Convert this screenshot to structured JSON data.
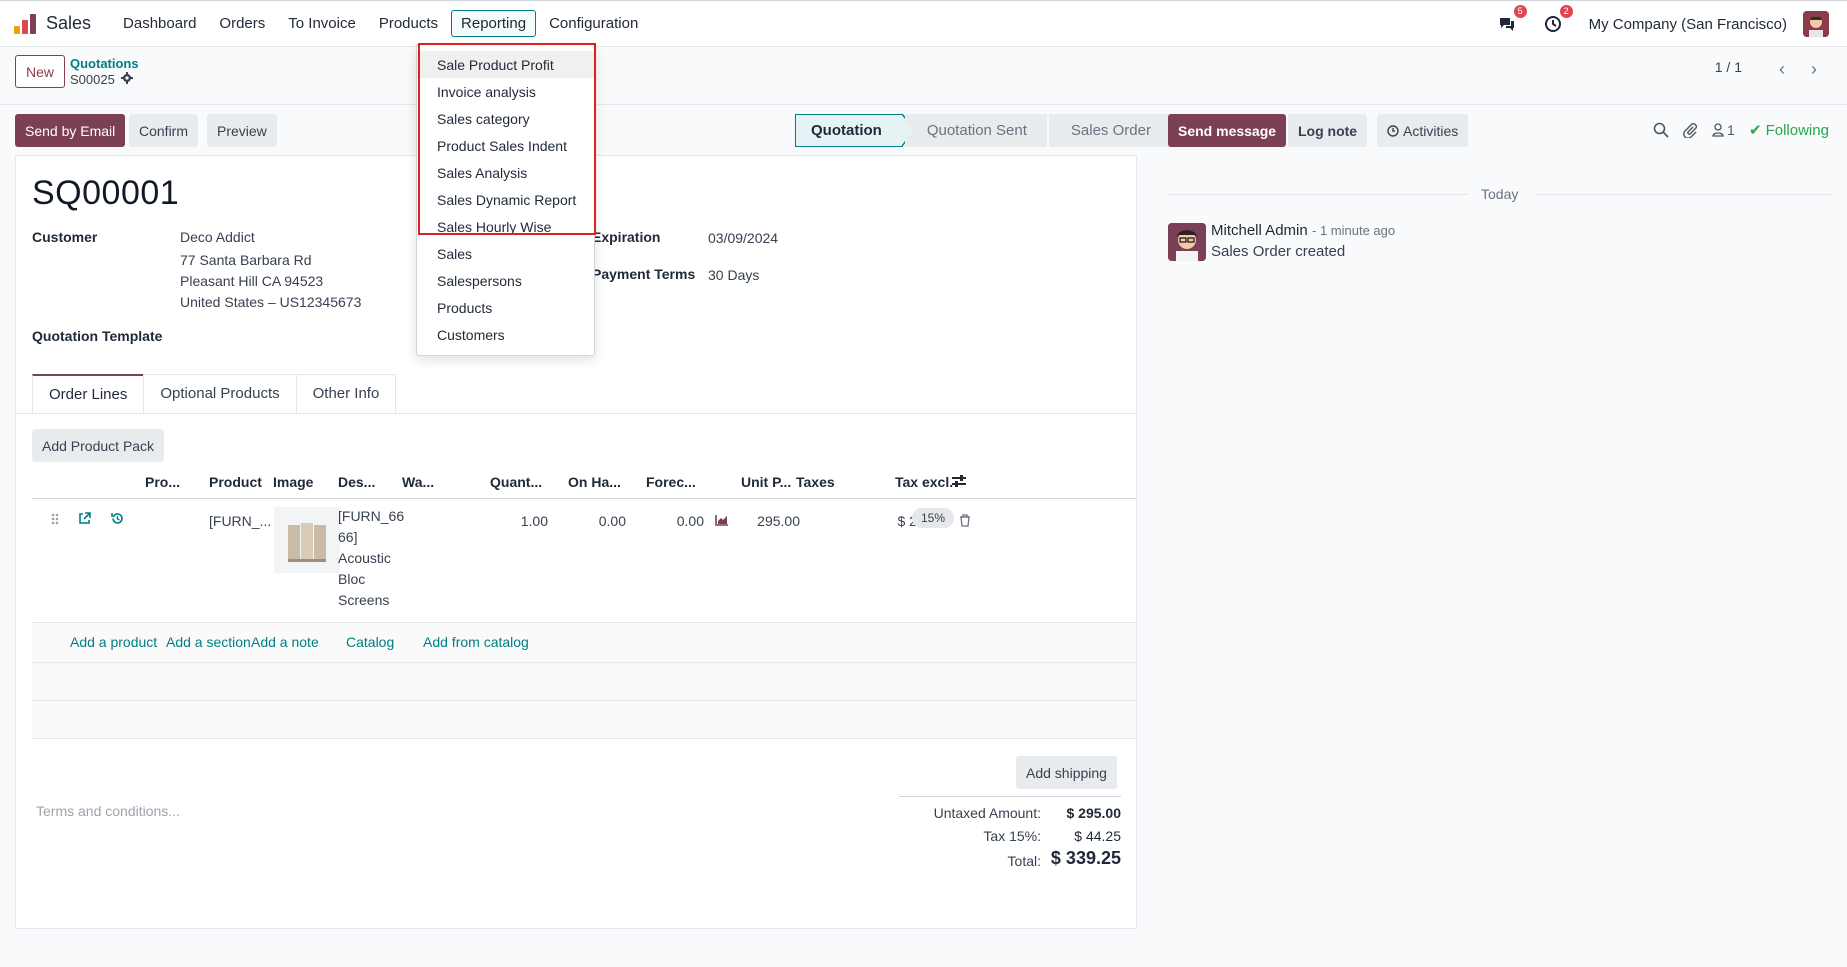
{
  "navbar": {
    "app_name": "Sales",
    "menu": [
      "Dashboard",
      "Orders",
      "To Invoice",
      "Products",
      "Reporting",
      "Configuration"
    ],
    "active_menu": "Reporting",
    "messages_count": "5",
    "activities_count": "2",
    "company": "My Company (San Francisco)"
  },
  "control_panel": {
    "new_label": "New",
    "breadcrumb_parent": "Quotations",
    "breadcrumb_record": "S00025",
    "pager": "1 / 1"
  },
  "actions": {
    "send_by_email": "Send by Email",
    "confirm": "Confirm",
    "preview": "Preview"
  },
  "statusbar": {
    "stages": [
      "Quotation",
      "Quotation Sent",
      "Sales Order"
    ],
    "current": "Quotation"
  },
  "form": {
    "title": "SQ00001",
    "customer_label": "Customer",
    "customer_name": "Deco Addict",
    "customer_address": [
      "77 Santa Barbara Rd",
      "Pleasant Hill CA 94523",
      "United States – US12345673"
    ],
    "expiration_label": "Expiration",
    "expiration_value": "03/09/2024",
    "payment_terms_label": "Payment Terms",
    "payment_terms_value": "30 Days",
    "quotation_template_label": "Quotation Template"
  },
  "tabs": [
    "Order Lines",
    "Optional Products",
    "Other Info"
  ],
  "order_lines": {
    "add_pack": "Add Product Pack",
    "columns": [
      "Pro...",
      "Product",
      "Image",
      "Des...",
      "Wa...",
      "Quant...",
      "On Ha...",
      "Forec...",
      "Unit P...",
      "Taxes",
      "Tax excl."
    ],
    "rows": [
      {
        "product": "[FURN_...",
        "description": [
          "[FURN_66",
          "66]",
          "Acoustic",
          "Bloc",
          "Screens"
        ],
        "quantity": "1.00",
        "on_hand": "0.00",
        "forecast": "0.00",
        "unit_price": "295.00",
        "taxes": "15%",
        "tax_excl": "$ 295.00"
      }
    ],
    "add_links": [
      "Add a product",
      "Add a section",
      "Add a note",
      "Catalog",
      "Add from catalog"
    ],
    "add_shipping": "Add shipping",
    "terms_placeholder": "Terms and conditions..."
  },
  "totals": {
    "untaxed_label": "Untaxed Amount:",
    "untaxed_value": "$ 295.00",
    "tax_label": "Tax 15%:",
    "tax_value": "$ 44.25",
    "total_label": "Total:",
    "total_value": "$ 339.25"
  },
  "chatter": {
    "send_message": "Send message",
    "log_note": "Log note",
    "activities": "Activities",
    "followers_count": "1",
    "following": "Following",
    "date_separator": "Today",
    "message_author": "Mitchell Admin",
    "message_time": "- 1 minute ago",
    "message_body": "Sales Order created"
  },
  "reporting_menu": {
    "items": [
      "Sale Product Profit",
      "Invoice analysis",
      "Sales category",
      "Product Sales Indent",
      "Sales Analysis",
      "Sales Dynamic Report",
      "Sales Hourly Wise",
      "Sales",
      "Salespersons",
      "Products",
      "Customers"
    ]
  },
  "colors": {
    "brand": "#7b3f56",
    "accent": "#017e84",
    "highlight": "#e02020",
    "following": "#28a745"
  }
}
